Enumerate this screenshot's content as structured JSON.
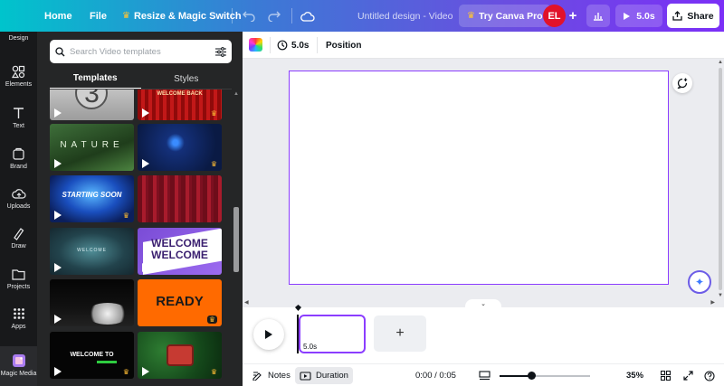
{
  "topbar": {
    "home": "Home",
    "file": "File",
    "resize": "Resize & Magic Switch",
    "doc_title": "Untitled design - Video",
    "try_pro": "Try Canva Pro",
    "avatar": "EL",
    "play_duration": "5.0s",
    "share": "Share"
  },
  "rail": {
    "items": [
      {
        "label": "Design",
        "icon": "design-icon"
      },
      {
        "label": "Elements",
        "icon": "elements-icon"
      },
      {
        "label": "Text",
        "icon": "text-icon"
      },
      {
        "label": "Brand",
        "icon": "brand-icon"
      },
      {
        "label": "Uploads",
        "icon": "uploads-icon"
      },
      {
        "label": "Draw",
        "icon": "draw-icon"
      },
      {
        "label": "Projects",
        "icon": "projects-icon"
      },
      {
        "label": "Apps",
        "icon": "apps-icon"
      },
      {
        "label": "Magic Media",
        "icon": "magic-media-icon"
      }
    ]
  },
  "panel": {
    "search_placeholder": "Search Video templates",
    "tabs": [
      "Templates",
      "Styles"
    ],
    "thumbs": [
      {
        "id": "t1",
        "text": "3",
        "premium": false
      },
      {
        "id": "t2",
        "text": "WELCOME BACK",
        "premium": true
      },
      {
        "id": "t3",
        "text": "NATURE",
        "premium": false
      },
      {
        "id": "t4",
        "text": "",
        "premium": true
      },
      {
        "id": "t5",
        "text": "STARTING SOON",
        "premium": true
      },
      {
        "id": "t6",
        "text": "",
        "premium": false
      },
      {
        "id": "t7",
        "text": "WELCOME",
        "premium": false
      },
      {
        "id": "t8a",
        "text": "WELCOME",
        "premium": false
      },
      {
        "id": "t8b",
        "text": "WELCOME",
        "premium": false
      },
      {
        "id": "t9",
        "text": "",
        "premium": false
      },
      {
        "id": "t10",
        "text": "READY",
        "premium": true
      },
      {
        "id": "t11",
        "text": "WELCOME TO",
        "premium": true
      },
      {
        "id": "t12",
        "text": "",
        "premium": true
      }
    ]
  },
  "editor": {
    "duration": "5.0s",
    "position": "Position"
  },
  "timeline": {
    "clip_duration": "5.0s"
  },
  "bottombar": {
    "notes": "Notes",
    "duration": "Duration",
    "time": "0:00 / 0:05",
    "zoom": "35%",
    "zoom_fraction": 0.35
  },
  "colors": {
    "accent": "#8b3dff",
    "avatar": "#e1122a",
    "rail_bg": "#18191b",
    "panel_bg": "#252627"
  }
}
